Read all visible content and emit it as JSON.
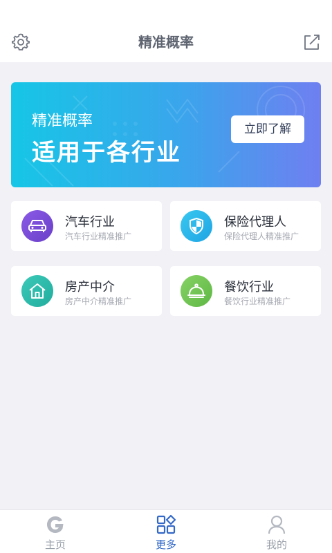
{
  "header": {
    "title": "精准概率",
    "settings_icon": "gear-icon",
    "share_icon": "share-icon"
  },
  "banner": {
    "line1": "精准概率",
    "line2": "适用于各行业",
    "cta_label": "立即了解",
    "colors": {
      "start": "#16c6e6",
      "end": "#6f7ff0"
    }
  },
  "categories": [
    {
      "title": "汽车行业",
      "subtitle": "汽车行业精准推广",
      "icon": "car-icon",
      "color": "#7b4fd8"
    },
    {
      "title": "保险代理人",
      "subtitle": "保险代理人精准推广",
      "icon": "shield-icon",
      "color": "#2bb6ea"
    },
    {
      "title": "房产中介",
      "subtitle": "房产中介精准推广",
      "icon": "house-icon",
      "color": "#2fbdb0"
    },
    {
      "title": "餐饮行业",
      "subtitle": "餐饮行业精准推广",
      "icon": "cloche-icon",
      "color": "#7ccb5c"
    }
  ],
  "tabbar": {
    "active_color": "#3268c8",
    "inactive_color": "#9aa0aa",
    "items": [
      {
        "label": "主页",
        "icon": "home-logo-icon",
        "active": false
      },
      {
        "label": "更多",
        "icon": "grid-icon",
        "active": true
      },
      {
        "label": "我的",
        "icon": "person-icon",
        "active": false
      }
    ]
  }
}
